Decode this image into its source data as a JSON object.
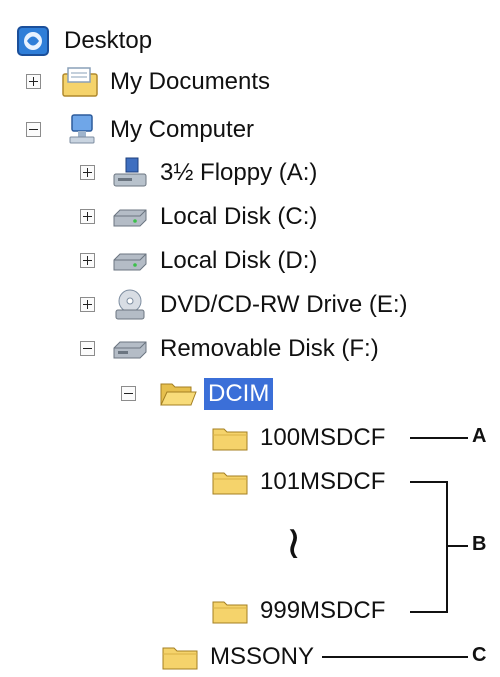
{
  "tree": {
    "desktop": "Desktop",
    "my_documents": "My Documents",
    "my_computer": "My Computer",
    "floppy": "3½ Floppy (A:)",
    "local_c": "Local Disk (C:)",
    "local_d": "Local Disk (D:)",
    "dvd": "DVD/CD-RW Drive (E:)",
    "removable": "Removable Disk (F:)",
    "dcim": "DCIM",
    "folder_100": "100MSDCF",
    "folder_101": "101MSDCF",
    "folder_999": "999MSDCF",
    "mssony": "MSSONY"
  },
  "annotations": {
    "a": "A",
    "b": "B",
    "c": "C",
    "ellipsis": "≀"
  },
  "colors": {
    "selection": "#3b6fd8",
    "folder": "#f5d36b"
  }
}
